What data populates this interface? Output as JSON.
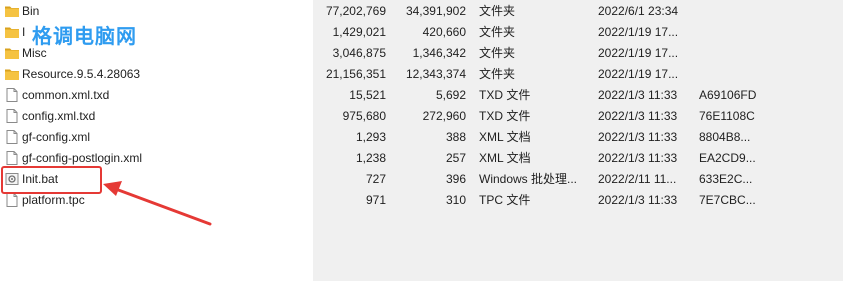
{
  "files": [
    {
      "name": "Bin",
      "icon": "folder-icon",
      "size": "77,202,769",
      "packed": "34,391,902",
      "type": "文件夹",
      "modified": "2022/6/1 23:34",
      "crc": "",
      "attributes": ""
    },
    {
      "name": "I",
      "icon": "folder-icon",
      "size": "1,429,021",
      "packed": "420,660",
      "type": "文件夹",
      "modified": "2022/1/19 17...",
      "crc": "",
      "attributes": ""
    },
    {
      "name": "Misc",
      "icon": "folder-icon",
      "size": "3,046,875",
      "packed": "1,346,342",
      "type": "文件夹",
      "modified": "2022/1/19 17...",
      "crc": "",
      "attributes": ""
    },
    {
      "name": "Resource.9.5.4.28063",
      "icon": "folder-icon",
      "size": "21,156,351",
      "packed": "12,343,374",
      "type": "文件夹",
      "modified": "2022/1/19 17...",
      "crc": "",
      "attributes": ""
    },
    {
      "name": "common.xml.txd",
      "icon": "file-icon",
      "size": "15,521",
      "packed": "5,692",
      "type": "TXD 文件",
      "modified": "2022/1/3 11:33",
      "crc": "A69106FD",
      "attributes": ""
    },
    {
      "name": "config.xml.txd",
      "icon": "file-icon",
      "size": "975,680",
      "packed": "272,960",
      "type": "TXD 文件",
      "modified": "2022/1/3 11:33",
      "crc": "76E1108C",
      "attributes": ""
    },
    {
      "name": "gf-config.xml",
      "icon": "file-icon",
      "size": "1,293",
      "packed": "388",
      "type": "XML 文档",
      "modified": "2022/1/3 11:33",
      "crc": "8804B8...",
      "attributes": ""
    },
    {
      "name": "gf-config-postlogin.xml",
      "icon": "file-icon",
      "size": "1,238",
      "packed": "257",
      "type": "XML 文档",
      "modified": "2022/1/3 11:33",
      "crc": "EA2CD9...",
      "attributes": ""
    },
    {
      "name": "Init.bat",
      "icon": "batch-file-icon",
      "size": "727",
      "packed": "396",
      "type": "Windows 批处理...",
      "modified": "2022/2/11 11...",
      "crc": "633E2C...",
      "attributes": ""
    },
    {
      "name": "platform.tpc",
      "icon": "file-icon",
      "size": "971",
      "packed": "310",
      "type": "TPC 文件",
      "modified": "2022/1/3 11:33",
      "crc": "7E7CBC...",
      "attributes": ""
    }
  ],
  "watermark": {
    "text": "格调电脑网"
  },
  "annotation": {
    "color": "#e53935",
    "target": "Init.bat"
  },
  "colors": {
    "folder": "#f5c342",
    "folder_dark": "#d9a21e",
    "background_panel": "#f0f0f0"
  }
}
